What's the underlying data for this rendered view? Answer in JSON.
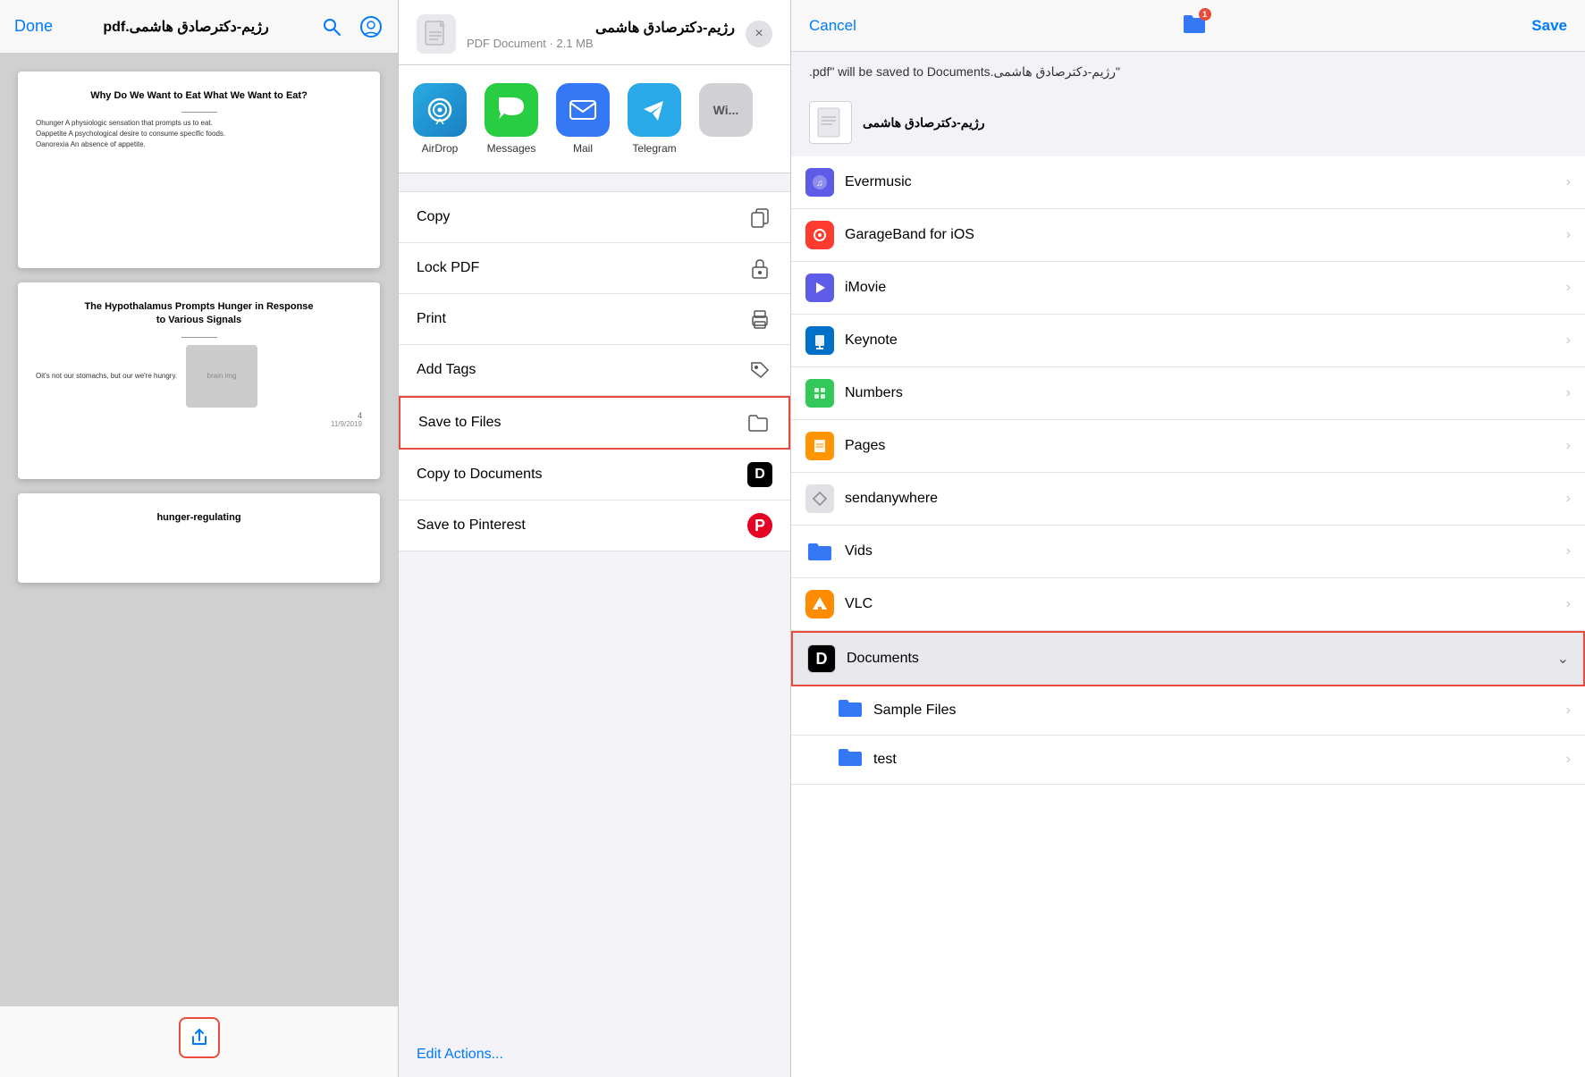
{
  "pdf_viewer": {
    "toolbar": {
      "done_label": "Done",
      "title": "رژیم-دکترصادق هاشمی.pdf"
    },
    "pages": [
      {
        "title": "Why Do We Want to Eat What We Want to Eat?",
        "lines": [
          "Ohunger A physiologic sensation that prompts us to eat.",
          "Oappetite A psychological desire to consume specific foods.",
          "Oanorexia An absence of appetite."
        ]
      },
      {
        "title": "The Hypothalamus Prompts Hunger in Response\nto Various Signals",
        "lines": [
          "Oit's not our stomachs, but our we're hungry."
        ],
        "has_image": true
      },
      {
        "title": "hunger-regulating",
        "lines": []
      }
    ],
    "page_number": "4",
    "date": "11/9/2019"
  },
  "share_sheet": {
    "header": {
      "file_name": "رژیم-دکترصادق هاشمی",
      "file_meta": "PDF Document · 2.1 MB",
      "close_label": "×"
    },
    "apps": [
      {
        "id": "airdrop",
        "label": "AirDrop"
      },
      {
        "id": "messages",
        "label": "Messages"
      },
      {
        "id": "mail",
        "label": "Mail"
      },
      {
        "id": "telegram",
        "label": "Telegram"
      },
      {
        "id": "more",
        "label": "Wi..."
      }
    ],
    "actions": [
      {
        "id": "copy",
        "label": "Copy",
        "icon": "📋"
      },
      {
        "id": "lock-pdf",
        "label": "Lock PDF",
        "icon": "🔒"
      },
      {
        "id": "print",
        "label": "Print",
        "icon": "🖨"
      },
      {
        "id": "add-tags",
        "label": "Add Tags",
        "icon": "🏷"
      },
      {
        "id": "save-to-files",
        "label": "Save to Files",
        "icon": "📁",
        "highlighted": true
      },
      {
        "id": "copy-to-documents",
        "label": "Copy to Documents",
        "icon": "D"
      },
      {
        "id": "save-to-pinterest",
        "label": "Save to Pinterest",
        "icon": "P"
      }
    ],
    "edit_actions_label": "Edit Actions..."
  },
  "save_dialog": {
    "header": {
      "cancel_label": "Cancel",
      "save_label": "Save"
    },
    "description": "\"رژیم-دکترصادق هاشمی.pdf\" will be saved to Documents.",
    "preview_name": "رژیم-دکترصادق هاشمی",
    "folders": [
      {
        "id": "evermusic",
        "name": "Evermusic",
        "icon_color": "#5e5ce6",
        "type": "app"
      },
      {
        "id": "garageband",
        "name": "GarageBand for iOS",
        "icon_color": "#ff3b30",
        "type": "app"
      },
      {
        "id": "imovie",
        "name": "iMovie",
        "icon_color": "#5e5ce6",
        "type": "app"
      },
      {
        "id": "keynote",
        "name": "Keynote",
        "icon_color": "#0070c9",
        "type": "app"
      },
      {
        "id": "numbers",
        "name": "Numbers",
        "icon_color": "#34c759",
        "type": "app"
      },
      {
        "id": "pages",
        "name": "Pages",
        "icon_color": "#ff9500",
        "type": "app"
      },
      {
        "id": "sendanywhere",
        "name": "sendanywhere",
        "icon_color": "#e0e0e5",
        "type": "app"
      },
      {
        "id": "vids",
        "name": "Vids",
        "icon_color": "#3478f6",
        "type": "folder"
      },
      {
        "id": "vlc",
        "name": "VLC",
        "icon_color": "#ff8c00",
        "type": "app"
      },
      {
        "id": "documents",
        "name": "Documents",
        "icon_color": "#e74c3c",
        "type": "app",
        "selected": true,
        "expanded": true
      },
      {
        "id": "sample-files",
        "name": "Sample Files",
        "icon_color": "#3478f6",
        "type": "subfolder"
      },
      {
        "id": "test",
        "name": "test",
        "icon_color": "#3478f6",
        "type": "subfolder"
      }
    ]
  }
}
